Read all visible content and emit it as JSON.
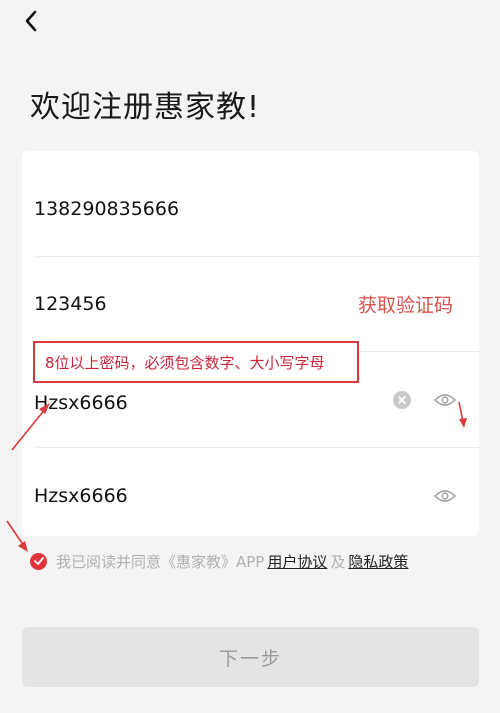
{
  "header": {
    "back_icon": "chevron-left-icon"
  },
  "page": {
    "title": "欢迎注册惠家教!"
  },
  "form": {
    "phone": {
      "value": "138290835666"
    },
    "code": {
      "value": "123456",
      "button_label": "获取验证码"
    },
    "password": {
      "value": "Hzsx6666"
    },
    "confirm_password": {
      "value": "Hzsx6666"
    },
    "hint": "8位以上密码，必须包含数字、大小写字母"
  },
  "agreement": {
    "checked": true,
    "text": "我已阅读并同意《惠家教》APP",
    "user_agreement": "用户协议",
    "and": "及",
    "privacy_policy": "隐私政策"
  },
  "actions": {
    "next_label": "下一步"
  },
  "colors": {
    "accent": "#e0353a",
    "annotation": "#d93a3a",
    "background": "#f4f4f4"
  }
}
